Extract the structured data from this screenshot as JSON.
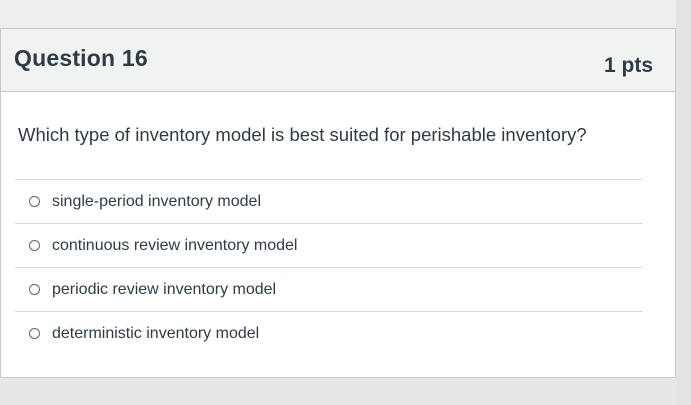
{
  "question": {
    "title": "Question 16",
    "points": "1 pts",
    "text": "Which type of inventory model is best suited for perishable inventory?",
    "cursor_glyph": "I"
  },
  "answers": [
    {
      "label": "single-period inventory model",
      "selected": false
    },
    {
      "label": "continuous review inventory model",
      "selected": false
    },
    {
      "label": "periodic review inventory model",
      "selected": false
    },
    {
      "label": "deterministic inventory model",
      "selected": false
    }
  ],
  "colors": {
    "text": "#2d3b45",
    "header_bg": "#f1f3f2",
    "border": "#c7cbc8"
  }
}
